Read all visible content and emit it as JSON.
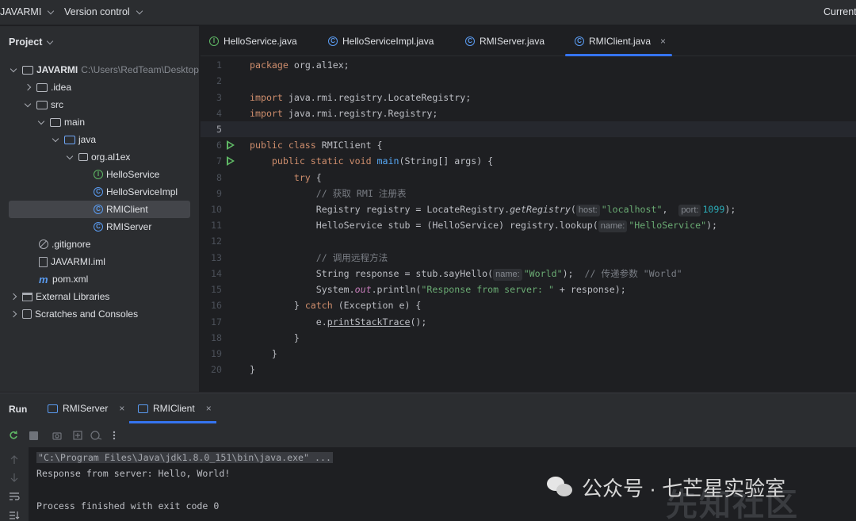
{
  "titlebar": {
    "project": "JAVARMI",
    "vcs": "Version control",
    "right": "Current"
  },
  "project_panel": {
    "title": "Project",
    "tree": [
      {
        "label": "JAVARMI",
        "path": "C:\\Users\\RedTeam\\Desktop"
      },
      {
        "label": ".idea"
      },
      {
        "label": "src"
      },
      {
        "label": "main"
      },
      {
        "label": "java"
      },
      {
        "label": "org.al1ex"
      },
      {
        "label": "HelloService"
      },
      {
        "label": "HelloServiceImpl"
      },
      {
        "label": "RMIClient"
      },
      {
        "label": "RMIServer"
      },
      {
        "label": ".gitignore"
      },
      {
        "label": "JAVARMI.iml"
      },
      {
        "label": "pom.xml"
      },
      {
        "label": "External Libraries"
      },
      {
        "label": "Scratches and Consoles"
      }
    ]
  },
  "tabs": [
    {
      "label": "HelloService.java",
      "icon": "interface-icon"
    },
    {
      "label": "HelloServiceImpl.java",
      "icon": "class-icon"
    },
    {
      "label": "RMIServer.java",
      "icon": "class-icon"
    },
    {
      "label": "RMIClient.java",
      "icon": "class-icon",
      "active": true,
      "close": "×"
    }
  ],
  "editor": {
    "line_numbers": [
      "1",
      "2",
      "3",
      "4",
      "5",
      "6",
      "7",
      "8",
      "9",
      "10",
      "11",
      "12",
      "13",
      "14",
      "15",
      "16",
      "17",
      "18",
      "19",
      "20"
    ],
    "code": {
      "l1a": "package",
      "l1b": " org.al1ex;",
      "l3a": "import",
      "l3b": " java.rmi.registry.LocateRegistry;",
      "l4a": "import",
      "l4b": " java.rmi.registry.Registry;",
      "l6a": "public class",
      "l6b": " RMIClient {",
      "l7a": "    public static void ",
      "l7b": "main",
      "l7c": "(String[] args) {",
      "l8a": "        try",
      "l8b": " {",
      "l9": "            // 获取 RMI 注册表",
      "l10a": "            Registry registry = LocateRegistry.",
      "l10b": "getRegistry",
      "l10c": "(",
      "l10h1": "host:",
      "l10d": "\"localhost\"",
      "l10e": ",  ",
      "l10h2": "port:",
      "l10f": "1099",
      "l10g": ");",
      "l11a": "            HelloService stub = (HelloService) registry.lookup(",
      "l11h": "name:",
      "l11b": "\"HelloService\"",
      "l11c": ");",
      "l13": "            // 调用远程方法",
      "l14a": "            String response = stub.sayHello(",
      "l14h": "name:",
      "l14b": "\"World\"",
      "l14c": ");  ",
      "l14d": "// 传递参数 \"World\"",
      "l15a": "            System.",
      "l15b": "out",
      "l15c": ".println(",
      "l15d": "\"Response from server: \"",
      "l15e": " + response);",
      "l16a": "        } ",
      "l16b": "catch",
      "l16c": " (Exception e) {",
      "l17a": "            e.",
      "l17b": "printStackTrace",
      "l17c": "();",
      "l18": "        }",
      "l19": "    }",
      "l20": "}"
    }
  },
  "run_panel": {
    "title": "Run",
    "tabs": [
      {
        "label": "RMIServer",
        "close": "×"
      },
      {
        "label": "RMIClient",
        "close": "×",
        "active": true
      }
    ],
    "console": [
      "\"C:\\Program Files\\Java\\jdk1.8.0_151\\bin\\java.exe\" ...",
      "Response from server: Hello, World!",
      "",
      "Process finished with exit code 0"
    ]
  },
  "watermark": {
    "text": "公众号 · 七芒星实验室",
    "bg_text": "先知社区"
  }
}
